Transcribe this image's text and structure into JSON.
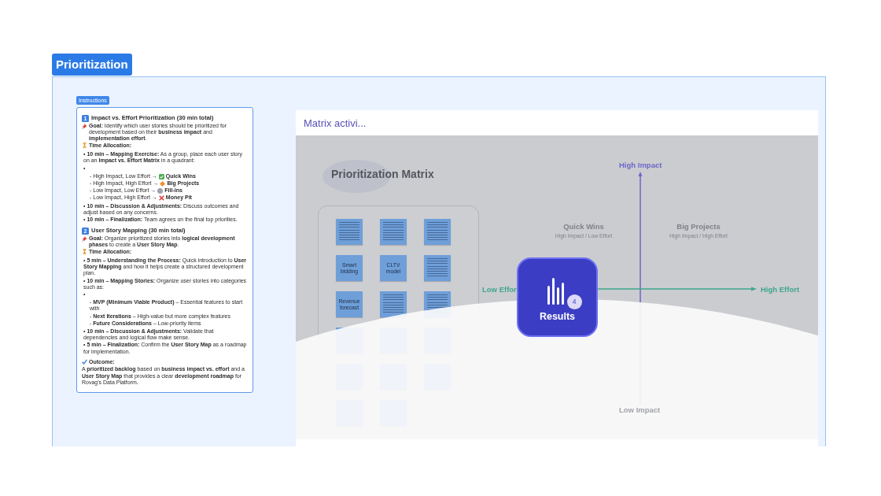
{
  "frame": {
    "title": "Prioritization"
  },
  "instructions": {
    "label": "Instructions",
    "sections": [
      {
        "number": "1",
        "title": "Impact vs. Effort Prioritization (30 min total)",
        "goal": "**Goal:** Identify which user stories should be prioritized for development based on their **business impact** and **implementation effort**.",
        "time_label": "Time Allocation:",
        "items": [
          {
            "text": "• **10 min – Mapping Exercise:** As a group, place each user story on an **Impact vs. Effort Matrix** in a quadrant:"
          },
          {
            "text": "•",
            "children": [
              {
                "kind": "win",
                "text": "- High Impact, Low Effort →",
                "label": "Quick Wins"
              },
              {
                "kind": "project",
                "text": "- High Impact, High Effort →",
                "label": "Big Projects"
              },
              {
                "kind": "fill",
                "text": "- Low Impact, Low Effort →",
                "label": "Fill-ins"
              },
              {
                "kind": "pit",
                "text": "- Low Impact, High Effort →",
                "label": "Money Pit"
              }
            ]
          },
          {
            "text": "• **10 min – Discussion & Adjustments:** Discuss outcomes and adjust based on any concerns."
          },
          {
            "text": "• **10 min – Finalization:** Team agrees on the final top priorities."
          }
        ]
      },
      {
        "number": "2",
        "title": "User Story Mapping (30 min total)",
        "goal": "**Goal:** Organize prioritized stories into **logical development phases** to create a **User Story Map**.",
        "time_label": "Time Allocation:",
        "items": [
          {
            "text": "• **5 min – Understanding the Process:** Quick introduction to **User Story Mapping** and how it helps create a structured development plan."
          },
          {
            "text": "• **10 min – Mapping Stories:** Organize user stories into categories such as:"
          },
          {
            "text": "•",
            "children": [
              {
                "kind": "plain",
                "text": "- **MVP (Minimum Viable Product)** – Essential features to start with"
              },
              {
                "kind": "plain",
                "text": "- **Next Iterations** – High-value but more complex features"
              },
              {
                "kind": "plain",
                "text": "- **Future Considerations** – Low-priority items"
              }
            ]
          },
          {
            "text": "• **10 min – Discussion & Adjustments:** Validate that dependencies and logical flow make sense."
          },
          {
            "text": "• **5 min – Finalization:** Confirm the **User Story Map** as a roadmap for implementation."
          }
        ]
      }
    ],
    "outcome": {
      "title": "Outcome:",
      "text": "A **prioritized backlog** based on **business impact vs. effort** and a **User Story Map** that provides a clear **development roadmap** for Rovag's Data Platform."
    }
  },
  "matrix_panel": {
    "title": "Matrix activi...",
    "board": {
      "title": "Prioritization Matrix",
      "notes": [
        {
          "kind": "scribble"
        },
        {
          "kind": "scribble"
        },
        {
          "kind": "scribble"
        },
        {
          "kind": "text",
          "text": "Smart bidding"
        },
        {
          "kind": "text",
          "text": "CLTV model"
        },
        {
          "kind": "scribble"
        },
        {
          "kind": "text",
          "text": "Revenue forecast"
        },
        {
          "kind": "scribble"
        },
        {
          "kind": "scribble"
        },
        {
          "kind": "blank"
        },
        {
          "kind": "blank"
        },
        {
          "kind": "blank"
        },
        {
          "kind": "blank"
        },
        {
          "kind": "blank"
        },
        {
          "kind": "blank"
        },
        {
          "kind": "blank"
        },
        {
          "kind": "blank"
        }
      ],
      "quadrants": [
        {
          "title": "Quick Wins",
          "subtitle": "High Impact / Low Effort"
        },
        {
          "title": "Big Projects",
          "subtitle": "High Impact / High Effort"
        }
      ],
      "axes": {
        "top": "High Impact",
        "right": "High Effort",
        "left": "Low Effor",
        "bottom": "Low Impact"
      }
    },
    "results": {
      "label": "Results",
      "count": "4"
    }
  }
}
